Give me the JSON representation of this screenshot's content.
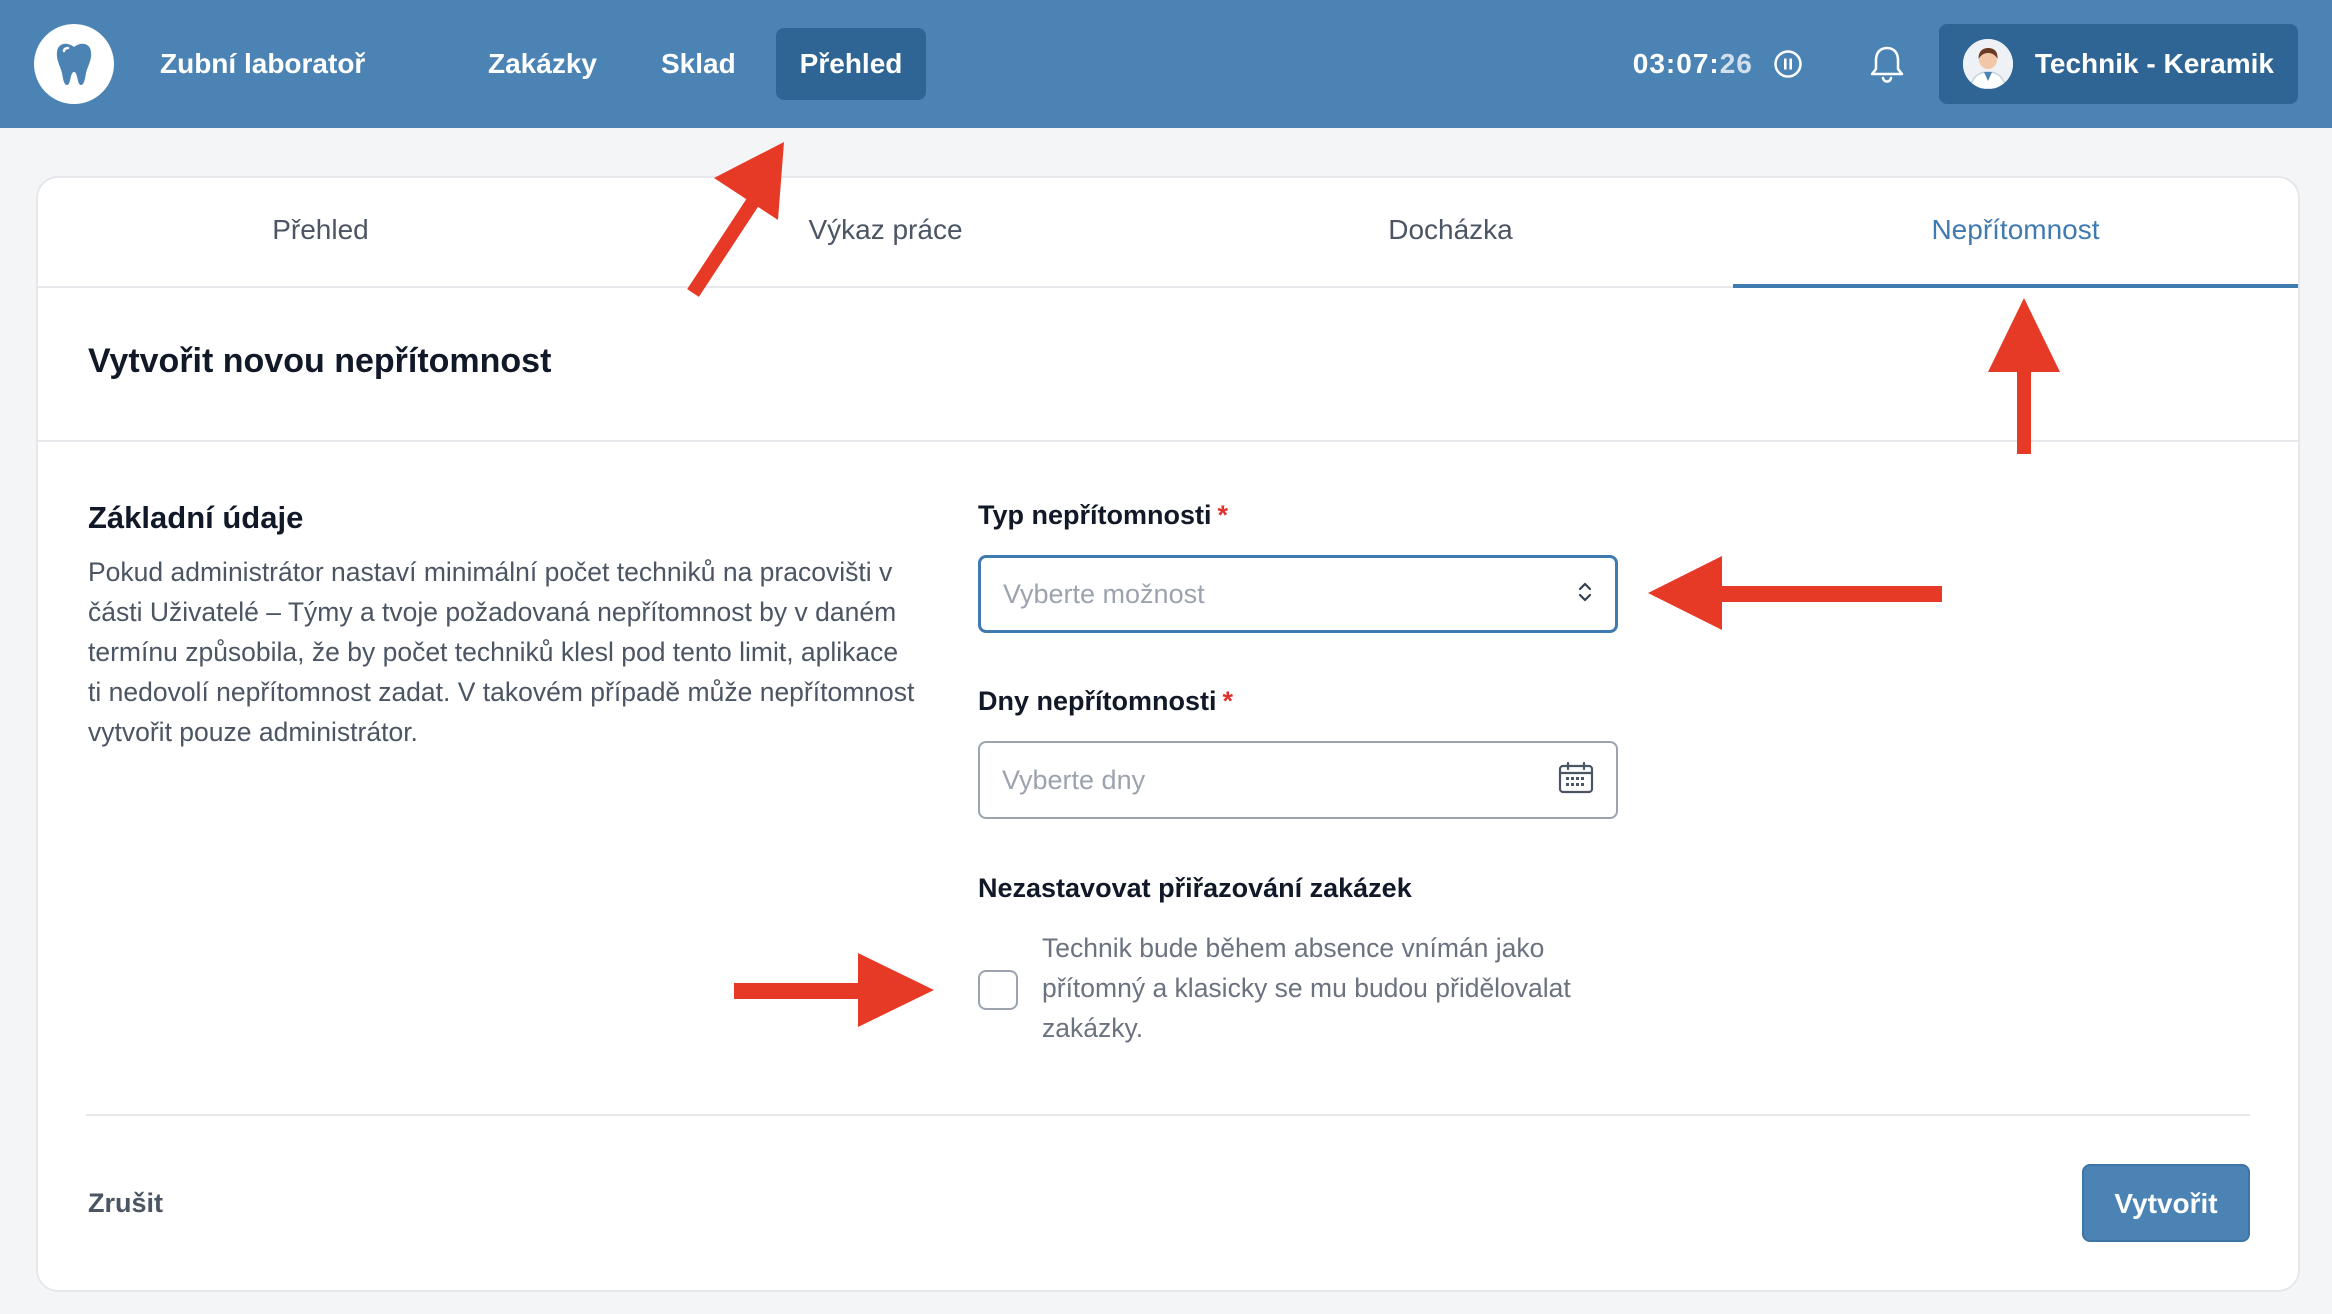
{
  "header": {
    "brand": "Zubní laboratoř",
    "nav": [
      {
        "label": "Zakázky",
        "active": false
      },
      {
        "label": "Sklad",
        "active": false
      },
      {
        "label": "Přehled",
        "active": true
      }
    ],
    "timer": {
      "main": "03:07:",
      "seconds": "26"
    },
    "user_name": "Technik - Keramik",
    "icons": {
      "logo": "tooth-icon",
      "pause": "pause-icon",
      "notifications": "bell-icon",
      "avatar": "user-avatar"
    }
  },
  "tabs": [
    {
      "label": "Přehled",
      "active": false
    },
    {
      "label": "Výkaz práce",
      "active": false
    },
    {
      "label": "Docházka",
      "active": false
    },
    {
      "label": "Nepřítomnost",
      "active": true
    }
  ],
  "form": {
    "title": "Vytvořit novou nepřítomnost",
    "section_title": "Základní údaje",
    "section_description": "Pokud administrátor nastaví minimální počet techniků na pracovišti v části Uživatelé – Týmy a tvoje požadovaná nepřítomnost by v daném termínu způsobila, že by počet techniků klesl pod tento limit, aplikace ti nedovolí nepřítomnost zadat. V takovém případě může nepřítomnost vytvořit pouze administrátor.",
    "absence_type": {
      "label": "Typ nepřítomnosti",
      "required_mark": "*",
      "placeholder": "Vyberte možnost"
    },
    "absence_days": {
      "label": "Dny nepřítomnosti",
      "required_mark": "*",
      "placeholder": "Vyberte dny"
    },
    "keep_assigning": {
      "label": "Nezastavovat přiřazování zakázek",
      "description": "Technik bude během absence vnímán jako přítomný a klasicky se mu budou přidělovalat zakázky.",
      "checked": false
    },
    "cancel_label": "Zrušit",
    "submit_label": "Vytvořit"
  },
  "colors": {
    "header_bg": "#4a83b4",
    "active_nav_bg": "#2e6594",
    "accent": "#3f7ab0",
    "required": "#e0312d",
    "annotation_arrow": "#e63a26"
  }
}
